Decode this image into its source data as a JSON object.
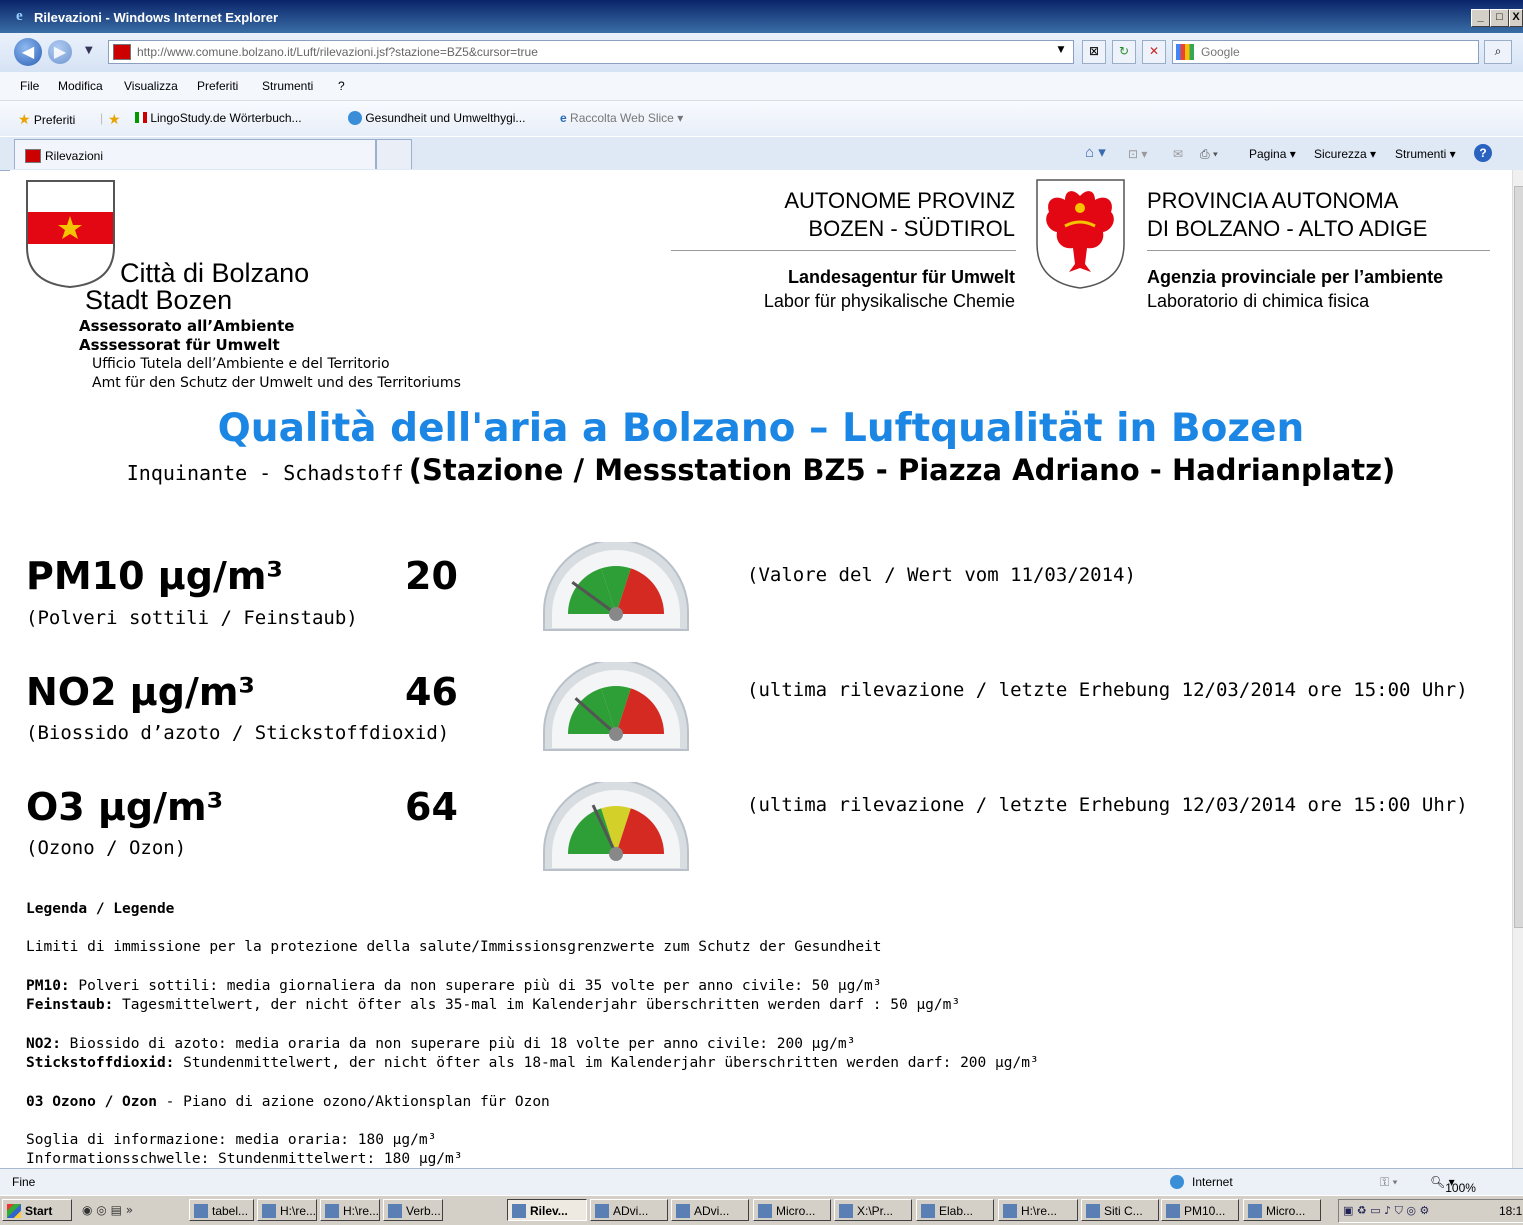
{
  "window": {
    "title": "Rilevazioni - Windows Internet Explorer",
    "min": "_",
    "max": "□",
    "close": "X"
  },
  "address": {
    "url": "http://www.comune.bolzano.it/Luft/rilevazioni.jsf?stazione=BZ5&cursor=true",
    "search_placeholder": "Google"
  },
  "menu": [
    "File",
    "Modifica",
    "Visualizza",
    "Preferiti",
    "Strumenti",
    "?"
  ],
  "favorites": {
    "label": "Preferiti",
    "items": [
      "LingoStudy.de Wörterbuch...",
      "Gesundheit und Umwelthygi...",
      "Raccolta Web Slice ▾"
    ]
  },
  "tab": {
    "label": "Rilevazioni"
  },
  "commands": {
    "pagina": "Pagina ▾",
    "sicurezza": "Sicurezza ▾",
    "strumenti": "Strumenti ▾",
    "help": "?"
  },
  "header": {
    "city_it": "Città di Bolzano",
    "city_de": "Stadt Bozen",
    "dept_it": "Assessorato all’Ambiente",
    "dept_de": "Asssessorat für Umwelt",
    "office_it": "Ufficio Tutela dell’Ambiente e del Territorio",
    "office_de": "Amt für den Schutz der Umwelt und des Territoriums",
    "prov_de_1": "AUTONOME PROVINZ",
    "prov_de_2": "BOZEN - SÜDTIROL",
    "prov_it_1": "PROVINCIA AUTONOMA",
    "prov_it_2": "DI BOLZANO - ALTO ADIGE",
    "agency_de": "Landesagentur für Umwelt",
    "lab_de": "Labor für physikalische Chemie",
    "agency_it": "Agenzia provinciale per l’ambiente",
    "lab_it": "Laboratorio di chimica fisica"
  },
  "title": "Qualità dell'aria a Bolzano – Luftqualität in Bozen",
  "subtitle_small": "Inquinante - Schadstoff",
  "subtitle_big": "(Stazione / Messstation BZ5 - Piazza Adriano - Hadrianplatz)",
  "pollutants": [
    {
      "name": "PM10 µg/m³",
      "sub": "(Polveri sottili / Feinstaub)",
      "value": "20",
      "date": "(Valore del / Wert vom 11/03/2014)",
      "gauge_level": 0.2,
      "gauge_colors": [
        "#2e9e37",
        "#2e9e37",
        "#d42a22"
      ]
    },
    {
      "name": "NO2 µg/m³",
      "sub": "(Biossido d’azoto / Stickstoffdioxid)",
      "value": "46",
      "date": "(ultima rilevazione / letzte Erhebung 12/03/2014 ore 15:00 Uhr)",
      "gauge_level": 0.23,
      "gauge_colors": [
        "#2e9e37",
        "#2e9e37",
        "#d42a22"
      ]
    },
    {
      "name": "O3 µg/m³",
      "sub": "(Ozono / Ozon)",
      "value": "64",
      "date": "(ultima rilevazione / letzte Erhebung 12/03/2014 ore 15:00 Uhr)",
      "gauge_level": 0.36,
      "gauge_colors": [
        "#2e9e37",
        "#d4d02a",
        "#d42a22"
      ]
    }
  ],
  "legend": {
    "title": "Legenda / Legende",
    "intro": "Limiti di immissione per la protezione della salute/Immissionsgrenzwerte zum Schutz der Gesundheit",
    "pm10_it_b": "PM10:",
    "pm10_it": " Polveri sottili: media giornaliera da non superare più di 35 volte per anno civile: 50 µg/m³",
    "pm10_de_b": "Feinstaub:",
    "pm10_de": " Tagesmittelwert, der nicht öfter als 35-mal im Kalenderjahr überschritten werden darf : 50 µg/m³",
    "no2_it_b": "NO2:",
    "no2_it": " Biossido di azoto: media oraria da non superare più di 18 volte per anno civile: 200 µg/m³",
    "no2_de_b": "Stickstoffdioxid:",
    "no2_de": " Stundenmittelwert, der nicht öfter als 18-mal im Kalenderjahr überschritten werden darf: 200 µg/m³",
    "o3_b": "03 Ozono / Ozon",
    "o3": " - Piano di azione ozono/Aktionsplan für Ozon",
    "o3_it": "Soglia di informazione: media oraria: 180 µg/m³",
    "o3_de": "Informationsschwelle: Stundenmittelwert: 180 µg/m³"
  },
  "status": {
    "left": "Fine",
    "zone": "Internet",
    "zoom": "100%"
  },
  "taskbar": {
    "start": "Start",
    "tasks": [
      "tabel...",
      "H:\\re...",
      "H:\\re...",
      "Verb...",
      "Rilev...",
      "ADvi...",
      "ADvi...",
      "Micro...",
      "X:\\Pr...",
      "Elab...",
      "H:\\re...",
      "Siti C...",
      "PM10...",
      "Micro..."
    ],
    "clock": "18:1"
  }
}
